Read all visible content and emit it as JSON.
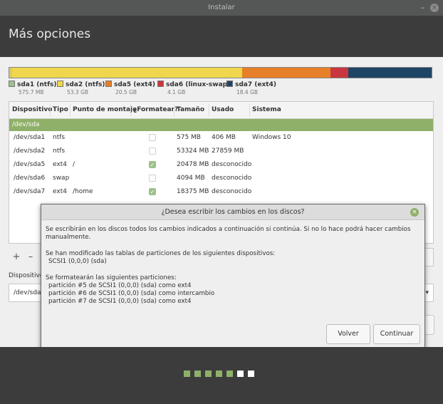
{
  "window": {
    "title": "Instalar",
    "minimize": "–",
    "close": "×"
  },
  "page": {
    "title": "Más opciones"
  },
  "partition_bar": [
    {
      "name": "sda1",
      "color": "#e0c95a",
      "fraction": 0.006
    },
    {
      "name": "sda2",
      "color": "#f0d64d",
      "fraction": 0.545
    },
    {
      "name": "sda5",
      "color": "#e67f2a",
      "fraction": 0.209
    },
    {
      "name": "sda6",
      "color": "#c8373f",
      "fraction": 0.042
    },
    {
      "name": "sda7",
      "color": "#1f4566",
      "fraction": 0.198
    }
  ],
  "legend": [
    {
      "label": "sda1 (ntfs)",
      "size": "575.7 MB",
      "color": "#9bc28a"
    },
    {
      "label": "sda2 (ntfs)",
      "size": "53.3 GB",
      "color": "#f0d64d"
    },
    {
      "label": "sda5 (ext4)",
      "size": "20.5 GB",
      "color": "#e67f2a"
    },
    {
      "label": "sda6 (linux-swap)",
      "size": "4.1 GB",
      "color": "#c8373f"
    },
    {
      "label": "sda7 (ext4)",
      "size": "18.4 GB",
      "color": "#1f4566"
    }
  ],
  "table": {
    "headers": [
      "Dispositivo",
      "Tipo",
      "Punto de montaje",
      "¿Formatear?",
      "Tamaño",
      "Usado",
      "Sistema"
    ],
    "group": "/dev/sda",
    "rows": [
      {
        "device": "/dev/sda1",
        "type": "ntfs",
        "mount": "",
        "format": false,
        "size": "575 MB",
        "used": "406 MB",
        "system": "Windows 10"
      },
      {
        "device": "/dev/sda2",
        "type": "ntfs",
        "mount": "",
        "format": false,
        "size": "53324 MB",
        "used": "27859 MB",
        "system": ""
      },
      {
        "device": "/dev/sda5",
        "type": "ext4",
        "mount": "/",
        "format": true,
        "size": "20478 MB",
        "used": "desconocido",
        "system": ""
      },
      {
        "device": "/dev/sda6",
        "type": "swap",
        "mount": "",
        "format": false,
        "size": "4094 MB",
        "used": "desconocido",
        "system": ""
      },
      {
        "device": "/dev/sda7",
        "type": "ext4",
        "mount": "/home",
        "format": true,
        "size": "18375 MB",
        "used": "desconocido",
        "system": ""
      }
    ]
  },
  "toolbar": {
    "add": "+",
    "remove": "–"
  },
  "boot": {
    "label": "Dispositivo",
    "value": "/dev/sda"
  },
  "dialog": {
    "title": "¿Desea escribir los cambios en los discos?",
    "intro": "Se escribirán en los discos todos los cambios indicados a continuación si continúa. Si no lo hace podrá hacer cambios manualmente.",
    "modified_heading": "Se han modificado las tablas de particiones de los siguientes dispositivos:",
    "modified_device": "SCSI1 (0,0,0) (sda)",
    "format_heading": "Se formatearán las siguientes particiones:",
    "format_items": [
      "partición #5 de SCSI1 (0,0,0) (sda) como ext4",
      "partición #6 de SCSI1 (0,0,0) (sda) como intercambio",
      "partición #7 de SCSI1 (0,0,0) (sda) como ext4"
    ],
    "back_label": "Volver",
    "continue_label": "Continuar"
  },
  "progress": {
    "completed_steps": 5,
    "total_steps": 7,
    "done_color": "#8fb068",
    "todo_color": "#ffffff"
  }
}
